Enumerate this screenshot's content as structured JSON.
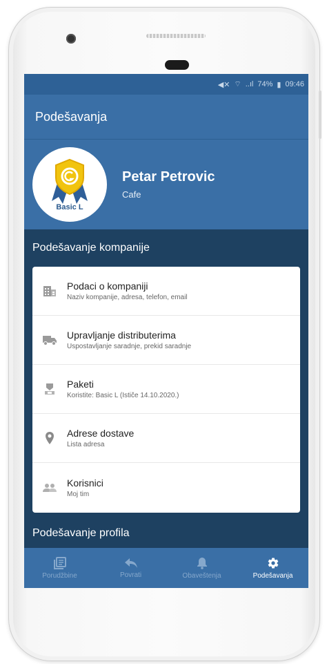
{
  "status_bar": {
    "battery": "74%",
    "time": "09:46",
    "signal": "..ıl"
  },
  "app_bar": {
    "title": "Podešavanja"
  },
  "profile": {
    "name": "Petar Petrovic",
    "type": "Cafe",
    "badge": "Basic L"
  },
  "company_section": {
    "title": "Podešavanje kompanije",
    "items": [
      {
        "icon": "building-icon",
        "title": "Podaci o kompaniji",
        "subtitle": "Naziv kompanije, adresa, telefon, email"
      },
      {
        "icon": "truck-icon",
        "title": "Upravljanje distributerima",
        "subtitle": "Uspostavljanje saradnje, prekid saradnje"
      },
      {
        "icon": "package-icon",
        "title": "Paketi",
        "subtitle": "Koristite: Basic L (Ističe 14.10.2020.)"
      },
      {
        "icon": "location-pin-icon",
        "title": "Adrese dostave",
        "subtitle": "Lista adresa"
      },
      {
        "icon": "people-icon",
        "title": "Korisnici",
        "subtitle": "Moj tim"
      }
    ]
  },
  "profile_section": {
    "title": "Podešavanje profila"
  },
  "bottom_nav": [
    {
      "icon": "orders-icon",
      "label": "Porudžbine",
      "active": false
    },
    {
      "icon": "return-icon",
      "label": "Povrati",
      "active": false
    },
    {
      "icon": "bell-icon",
      "label": "Obaveštenja",
      "active": false
    },
    {
      "icon": "gear-icon",
      "label": "Podešavanja",
      "active": true
    }
  ],
  "colors": {
    "primary": "#3a6fa6",
    "dark": "#1e4161",
    "status": "#2e6196"
  }
}
